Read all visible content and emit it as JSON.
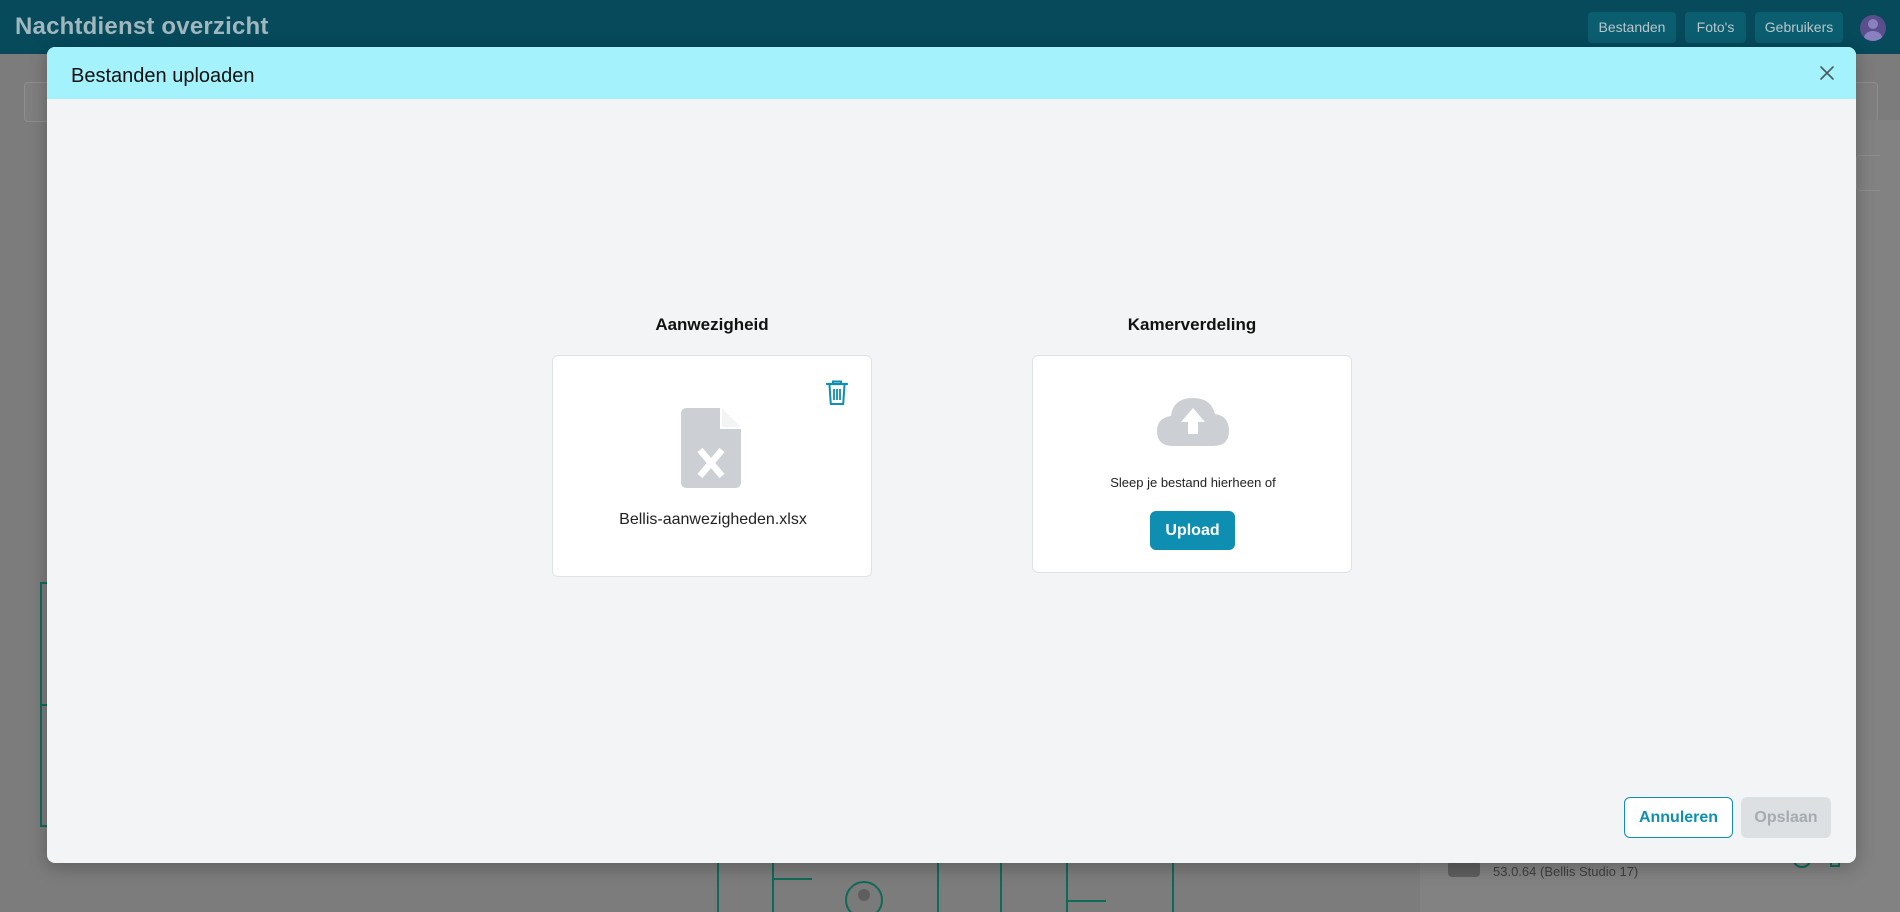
{
  "app": {
    "title": "Nachtdienst overzicht",
    "nav": {
      "files": "Bestanden",
      "photos": "Foto's",
      "users": "Gebruikers"
    },
    "footer_text": "53.0.64 (Bellis Studio 17)"
  },
  "modal": {
    "title": "Bestanden uploaden",
    "close_icon": "close-icon",
    "attendance": {
      "heading": "Aanwezigheid",
      "file_name": "Bellis-aanwezigheden.xlsx",
      "file_icon": "excel-file-icon",
      "delete_icon": "trash-icon"
    },
    "room_division": {
      "heading": "Kamerverdeling",
      "drop_text": "Sleep je bestand hierheen of",
      "upload_label": "Upload",
      "upload_icon": "cloud-upload-icon"
    },
    "cancel_label": "Annuleren",
    "save_label": "Opslaan"
  },
  "colors": {
    "accent": "#0e8fb1",
    "header_bg": "#a4f2fb",
    "topbar_bg": "#064a5c",
    "disabled_bg": "#dde0e3"
  }
}
